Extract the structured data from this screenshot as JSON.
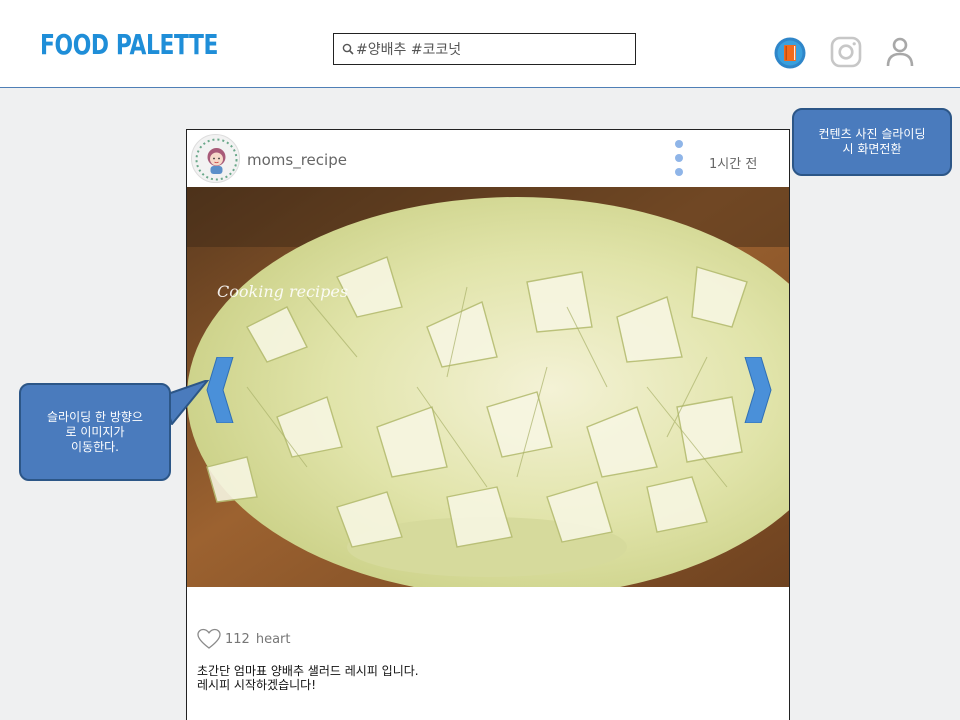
{
  "header": {
    "logo": "FOOD PALETTE",
    "search": {
      "value": "#양배추 #코코넛",
      "placeholder": ""
    },
    "icons": [
      "book-icon",
      "instagram-icon",
      "user-icon"
    ]
  },
  "post": {
    "username": "moms_recipe",
    "time": "1시간 전",
    "photo_watermark": "Cooking recipes",
    "likes": {
      "count": "112",
      "label": "heart"
    },
    "caption": [
      "초간단 엄마표 양배추 샐러드 레시피 입니다.",
      "레시피 시작하겠습니다!"
    ]
  },
  "annotations": {
    "top_right": [
      "컨텐츠 사진 슬라이딩",
      "시 화면전환"
    ],
    "left": [
      "슬라이딩 한 방향으",
      "로 이미지가",
      "이동한다."
    ]
  },
  "colors": {
    "accent": "#1f8ed8",
    "note_fill": "#4a7bbd",
    "note_border": "#2c5687",
    "arrow": "#4a90d9",
    "dots": "#8fb5e8"
  }
}
